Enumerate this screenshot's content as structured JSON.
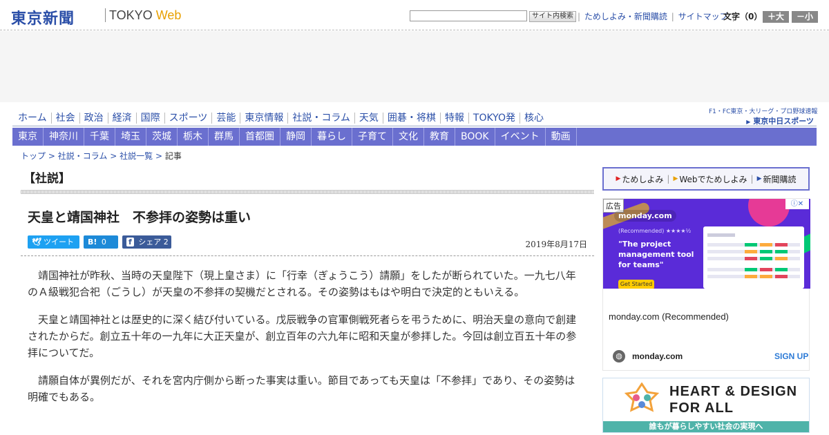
{
  "header": {
    "logo_jp": "東京新聞",
    "logo_tokyo": "TOKYO",
    "logo_web": "Web",
    "search_button": "サイト内検索",
    "links": [
      "ためしよみ・新聞購読",
      "サイトマップ"
    ],
    "font_label": "文字（0）",
    "font_larger": "＋大",
    "font_smaller": "－小"
  },
  "nav_primary": [
    "ホーム",
    "社会",
    "政治",
    "経済",
    "国際",
    "スポーツ",
    "芸能",
    "東京情報",
    "社説・コラム",
    "天気",
    "囲碁・将棋",
    "特報",
    "TOKYO発",
    "核心"
  ],
  "chunichi": {
    "line1": "F1・FC東京・大リーグ・プロ野球速報",
    "line2": "東京中日スポーツ"
  },
  "nav_secondary": [
    "東京",
    "神奈川",
    "千葉",
    "埼玉",
    "茨城",
    "栃木",
    "群馬",
    "首都圏",
    "静岡",
    "暮らし",
    "子育て",
    "文化",
    "教育",
    "BOOK",
    "イベント",
    "動画"
  ],
  "breadcrumb": {
    "items": [
      "トップ",
      "社説・コラム",
      "社説一覧"
    ],
    "current": "記事",
    "separator": ">"
  },
  "article": {
    "section": "【社説】",
    "headline": "天皇と靖国神社　不参拝の姿勢は重い",
    "date": "2019年8月17日",
    "share": {
      "tweet": "ツイート",
      "hatena_icon": "B!",
      "hatena_count": "0",
      "facebook_icon": "f",
      "facebook_label": "シェア",
      "facebook_count": "2"
    },
    "paragraphs": [
      "靖国神社が昨秋、当時の天皇陛下（現上皇さま）に「行幸（ぎょうこう）請願」をしたが断られていた。一九七八年のＡ級戦犯合祀（ごうし）が天皇の不参拝の契機だとされる。その姿勢はもはや明白で決定的ともいえる。",
      "天皇と靖国神社とは歴史的に深く結び付いている。戊辰戦争の官軍側戦死者らを弔うために、明治天皇の意向で創建されたからだ。創立五十年の一九年に大正天皇が、創立百年の六九年に昭和天皇が参拝した。今回は創立百五十年の参拝についてだ。",
      "請願自体が異例だが、それを宮内庁側から断った事実は重い。節目であっても天皇は「不参拝」であり、その姿勢は明確でもある。"
    ]
  },
  "sidebar": {
    "subscribe": [
      "ためしよみ",
      "Webでためしよみ",
      "新聞購読"
    ],
    "ad1": {
      "label": "広告",
      "close": "ⓘ✕",
      "brand": "monday.com",
      "recommended": "(Recommended) ★★★★½",
      "headline": "\"The project management tool for teams\"",
      "cta": "Get Started",
      "title": "monday.com (Recommended)",
      "domain": "monday.com",
      "signup": "SIGN UP"
    },
    "ad2": {
      "title1": "HEART & DESIGN",
      "title2": "FOR ALL",
      "band": "誰もが暮らしやすい社会の実現へ"
    }
  },
  "colors": {
    "brand_blue": "#2b4fa8",
    "nav_purple": "#6a6fcf",
    "twitter": "#1da1f2",
    "hatena": "#1d8ad8",
    "facebook": "#3b5b99",
    "monday_purple": "#5a2bd8",
    "teal": "#4fb3a9"
  }
}
